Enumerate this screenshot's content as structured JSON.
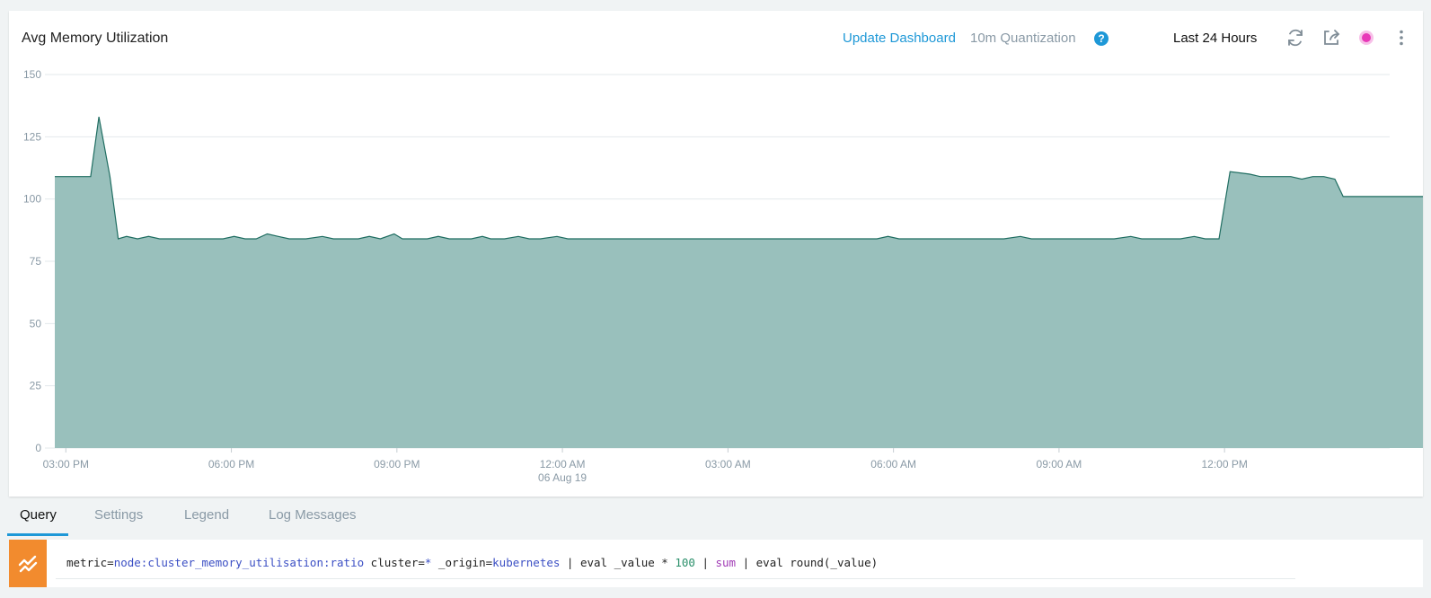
{
  "panel": {
    "title": "Avg Memory Utilization",
    "update_dashboard": "Update Dashboard",
    "quantization": "10m Quantization",
    "help_icon": "?",
    "time_range": "Last 24 Hours",
    "icons": [
      "refresh-icon",
      "share-icon",
      "live-dot-icon",
      "more-vert-icon"
    ]
  },
  "colors": {
    "area_fill": "#99c0bc",
    "area_line": "#1f6d61",
    "accent": "#1e98d7",
    "query_icon_bg": "#f28b2e",
    "live_dot": "#e838b8"
  },
  "chart_data": {
    "type": "area",
    "ylim": [
      0,
      150
    ],
    "y_ticks": [
      "0",
      "25",
      "50",
      "75",
      "100",
      "125",
      "150"
    ],
    "x_ticks": [
      {
        "label": "03:00 PM",
        "sub": ""
      },
      {
        "label": "06:00 PM",
        "sub": ""
      },
      {
        "label": "09:00 PM",
        "sub": ""
      },
      {
        "label": "12:00 AM",
        "sub": "06 Aug 19"
      },
      {
        "label": "03:00 AM",
        "sub": ""
      },
      {
        "label": "06:00 AM",
        "sub": ""
      },
      {
        "label": "09:00 AM",
        "sub": ""
      },
      {
        "label": "12:00 PM",
        "sub": ""
      }
    ],
    "x_start_hours": -0.2,
    "x_end_hours": 23.83,
    "grid": true,
    "legend": "none",
    "series": [
      {
        "points": [
          [
            -0.2,
            109
          ],
          [
            0.45,
            109
          ],
          [
            0.6,
            133
          ],
          [
            0.8,
            109
          ],
          [
            0.95,
            84
          ],
          [
            1.1,
            85
          ],
          [
            1.3,
            84
          ],
          [
            1.5,
            85
          ],
          [
            1.7,
            84
          ],
          [
            2.0,
            84
          ],
          [
            2.5,
            84
          ],
          [
            2.85,
            84
          ],
          [
            3.05,
            85
          ],
          [
            3.25,
            84
          ],
          [
            3.45,
            84
          ],
          [
            3.65,
            86
          ],
          [
            3.85,
            85
          ],
          [
            4.05,
            84
          ],
          [
            4.35,
            84
          ],
          [
            4.65,
            85
          ],
          [
            4.85,
            84
          ],
          [
            5.05,
            84
          ],
          [
            5.3,
            84
          ],
          [
            5.5,
            85
          ],
          [
            5.7,
            84
          ],
          [
            5.95,
            86
          ],
          [
            6.1,
            84
          ],
          [
            6.35,
            84
          ],
          [
            6.55,
            84
          ],
          [
            6.75,
            85
          ],
          [
            6.95,
            84
          ],
          [
            7.15,
            84
          ],
          [
            7.35,
            84
          ],
          [
            7.55,
            85
          ],
          [
            7.7,
            84
          ],
          [
            7.95,
            84
          ],
          [
            8.2,
            85
          ],
          [
            8.4,
            84
          ],
          [
            8.6,
            84
          ],
          [
            8.9,
            85
          ],
          [
            9.1,
            84
          ],
          [
            9.5,
            84
          ],
          [
            12,
            84
          ],
          [
            14.7,
            84
          ],
          [
            14.9,
            85
          ],
          [
            15.1,
            84
          ],
          [
            17,
            84
          ],
          [
            17.3,
            85
          ],
          [
            17.5,
            84
          ],
          [
            19,
            84
          ],
          [
            19.3,
            85
          ],
          [
            19.5,
            84
          ],
          [
            20.2,
            84
          ],
          [
            20.45,
            85
          ],
          [
            20.65,
            84
          ],
          [
            20.9,
            84
          ],
          [
            21.1,
            111
          ],
          [
            21.45,
            110
          ],
          [
            21.65,
            109
          ],
          [
            22.2,
            109
          ],
          [
            22.4,
            108
          ],
          [
            22.6,
            109
          ],
          [
            22.8,
            109
          ],
          [
            23.0,
            108
          ],
          [
            23.15,
            101
          ],
          [
            23.45,
            101
          ],
          [
            24.5,
            101
          ],
          [
            24.75,
            101
          ],
          [
            25.3,
            101
          ],
          [
            25.6,
            101
          ],
          [
            25.75,
            84
          ],
          [
            25.9,
            86
          ],
          [
            26.1,
            84
          ],
          [
            26.3,
            85
          ],
          [
            26.5,
            84
          ]
        ]
      }
    ]
  },
  "tabs": [
    {
      "label": "Query",
      "active": true
    },
    {
      "label": "Settings",
      "active": false
    },
    {
      "label": "Legend",
      "active": false
    },
    {
      "label": "Log Messages",
      "active": false
    }
  ],
  "query": {
    "icon": "chart-line-icon",
    "parts": [
      {
        "text": "metric=",
        "style": ""
      },
      {
        "text": "node:cluster_memory_utilisation:ratio",
        "style": "q-blue"
      },
      {
        "text": " cluster=",
        "style": ""
      },
      {
        "text": "*",
        "style": "q-blue"
      },
      {
        "text": " _origin=",
        "style": ""
      },
      {
        "text": "kubernetes",
        "style": "q-blue"
      },
      {
        "text": " | eval _value * ",
        "style": ""
      },
      {
        "text": "100",
        "style": "q-green"
      },
      {
        "text": " | ",
        "style": ""
      },
      {
        "text": "sum",
        "style": "q-purple"
      },
      {
        "text": " | eval round(_value)",
        "style": ""
      }
    ]
  }
}
